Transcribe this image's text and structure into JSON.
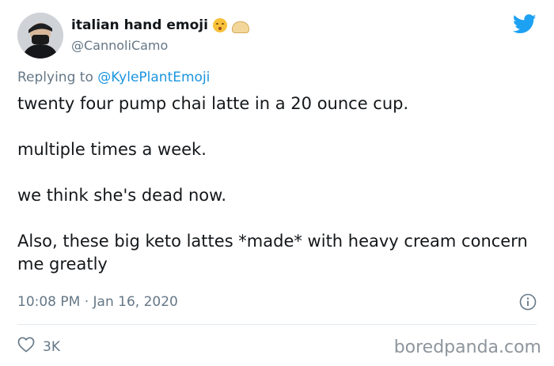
{
  "user": {
    "display_name": "italian hand emoji",
    "handle": "@CannoliCamo",
    "name_emojis": [
      "kissing-face-emoji",
      "dumpling-emoji"
    ]
  },
  "reply": {
    "prefix": "Replying to ",
    "mention": "@KylePlantEmoji"
  },
  "tweet": {
    "paragraphs": [
      "twenty four pump chai latte in a 20 ounce cup.",
      "multiple times a week.",
      "we think she's dead now.",
      "Also, these big keto lattes *made* with heavy cream concern me greatly"
    ],
    "timestamp": "10:08 PM · Jan 16, 2020"
  },
  "actions": {
    "like_count": "3K"
  },
  "watermark": "boredpanda.com",
  "colors": {
    "twitter_blue": "#1da1f2",
    "mention_blue": "#1b95e0",
    "secondary_text": "#657786"
  },
  "icons": {
    "brand": "twitter-bird-icon",
    "info": "info-icon",
    "like": "heart-icon"
  }
}
